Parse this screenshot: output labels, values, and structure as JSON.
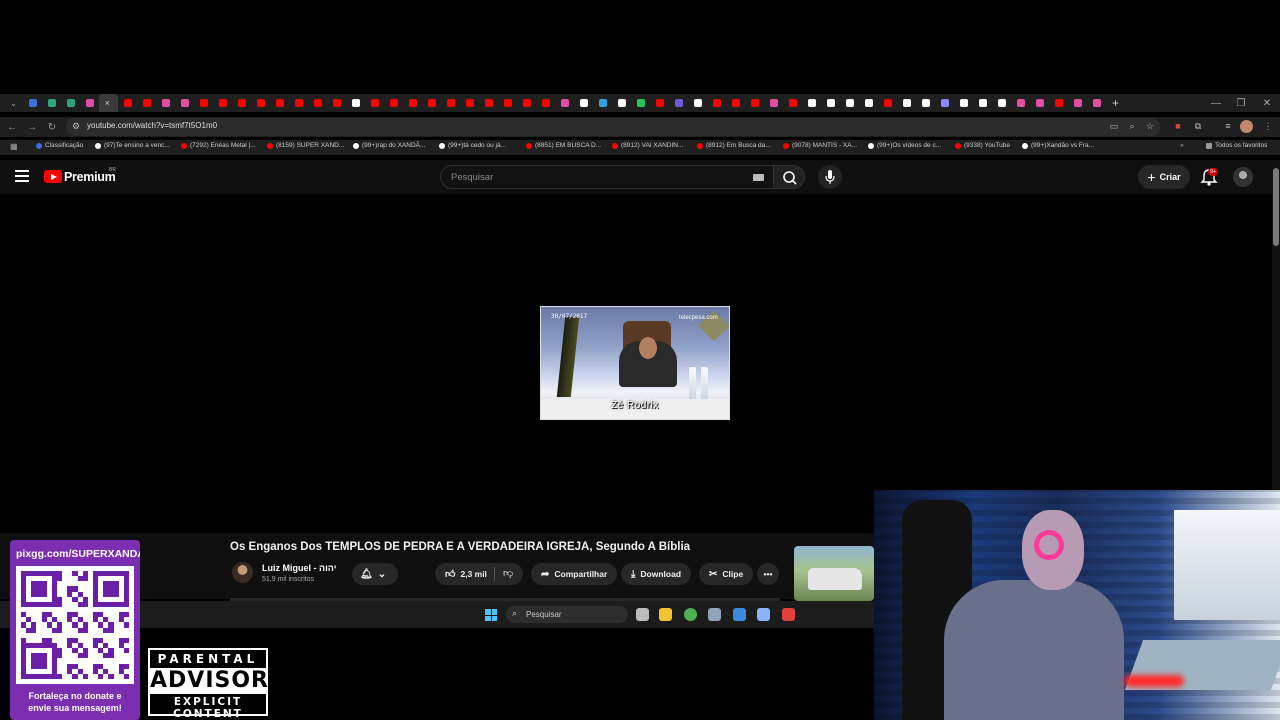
{
  "browser": {
    "url": "youtube.com/watch?v=tsmf7t5O1m0",
    "bookmarks": [
      {
        "label": "Classificação",
        "color": "#3b6fd8"
      },
      {
        "label": "(97)Te ensino a venc...",
        "color": "#ffffff"
      },
      {
        "label": "(7292) Enéas Metal |...",
        "color": "#ff0000"
      },
      {
        "label": "(8159) SUPER XAND...",
        "color": "#ff0000"
      },
      {
        "label": "(99+)rap do XANDÃ...",
        "color": "#ffffff"
      },
      {
        "label": "(99+)tá cedo ou já...",
        "color": "#ffffff"
      },
      {
        "label": "(8851) EM BUSCA D...",
        "color": "#ff0000"
      },
      {
        "label": "(8912) VAI XANDIN...",
        "color": "#ff0000"
      },
      {
        "label": "(8912) Em Busca da...",
        "color": "#ff0000"
      },
      {
        "label": "(9078) MANTIS - XA...",
        "color": "#ff0000"
      },
      {
        "label": "(99+)Os vídeos de c...",
        "color": "#ffffff"
      },
      {
        "label": "(9338) YouTube",
        "color": "#ff0000"
      },
      {
        "label": "(99+)Xandão vs Fra...",
        "color": "#ffffff"
      }
    ],
    "all_bookmarks": "Todos os favoritos",
    "tab_colors": [
      "#3b6fd8",
      "#2ea37a",
      "#2ea37a",
      "#e34fa0",
      "#ff0000",
      "#ff0000",
      "#ff0000",
      "#e34fa0",
      "#e34fa0",
      "#ff0000",
      "#ff0000",
      "#ff0000",
      "#ff0000",
      "#ff0000",
      "#ff0000",
      "#ff0000",
      "#ff0000",
      "#ffffff",
      "#ff0000",
      "#ff0000",
      "#ff0000",
      "#ff0000",
      "#ff0000",
      "#ff0000",
      "#ff0000",
      "#ff0000",
      "#ff0000",
      "#ff0000",
      "#e34fa0",
      "#ffffff",
      "#2ea3e0",
      "#ffffff",
      "#22c55e",
      "#ff0000",
      "#6b5bd6",
      "#ffffff",
      "#ff0000",
      "#ff0000",
      "#ff0000",
      "#e34fa0",
      "#ff0000",
      "#ffffff",
      "#ffffff",
      "#ffffff",
      "#ffffff",
      "#ff0000",
      "#ffffff",
      "#ffffff",
      "#8888ff",
      "#ffffff",
      "#ffffff",
      "#ffffff",
      "#e34fa0",
      "#e34fa0",
      "#ff0000",
      "#e34fa0",
      "#e34fa0"
    ]
  },
  "youtube": {
    "brand": "Premium",
    "region": "BR",
    "search_placeholder": "Pesquisar",
    "create_label": "Criar",
    "notification_count": "9+",
    "video": {
      "overlay_timestamp": "30/07/2017",
      "overlay_watermark": "telecpesa.com",
      "caption": "Zé Rodrix",
      "title": "Os Enganos Dos TEMPLOS DE PEDRA E A VERDADEIRA IGREJA, Segundo A Bíblia",
      "channel": "Luiz Miguel - יהוה",
      "subscribers": "51,9 mil inscritos",
      "likes": "2,3 mil",
      "share_label": "Compartilhar",
      "download_label": "Download",
      "clip_label": "Clipe"
    }
  },
  "taskbar": {
    "search_placeholder": "Pesquisar",
    "apps": [
      {
        "name": "task-view",
        "color": "#bcbcbc"
      },
      {
        "name": "file-explorer",
        "color": "#f4c430"
      },
      {
        "name": "chrome",
        "color": "#4caf50"
      },
      {
        "name": "settings",
        "color": "#8fa4b8"
      },
      {
        "name": "photos",
        "color": "#3a8dde"
      },
      {
        "name": "app-diamond",
        "color": "#8ab4f8"
      },
      {
        "name": "app-circle",
        "color": "#e04040"
      }
    ]
  },
  "overlay": {
    "donate_url": "pixgg.com/SUPERXANDA",
    "donate_message_1": "Fortaleça no donate e",
    "donate_message_2": "envie sua mensagem!",
    "advisory_line1": "PARENTAL",
    "advisory_line2": "ADVISORY",
    "advisory_line3": "EXPLICIT CONTENT"
  }
}
